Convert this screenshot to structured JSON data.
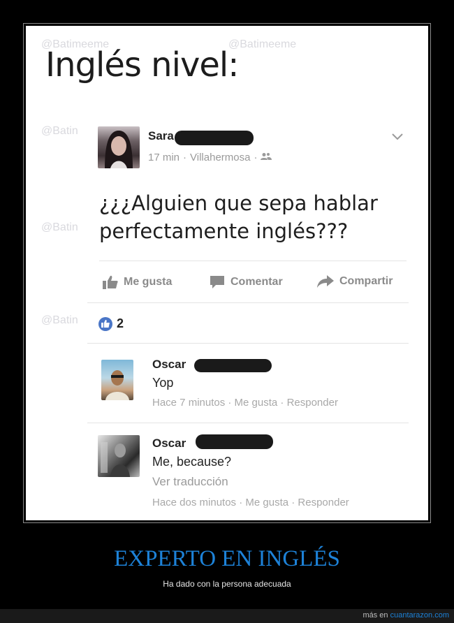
{
  "watermarks": [
    "@Batimeeme",
    "@Batimeeme",
    "@Batin",
    "@Batin",
    "@Batin"
  ],
  "headline": "Inglés nivel:",
  "post": {
    "author": "Sara",
    "time": "17 min",
    "location": "Villahermosa",
    "separator": "·",
    "text_line1": "¿¿¿Alguien que sepa hablar",
    "text_line2": "perfectamente inglés???",
    "actions": {
      "like": "Me gusta",
      "comment": "Comentar",
      "share": "Compartir"
    },
    "like_count": "2"
  },
  "comments": [
    {
      "author": "Oscar",
      "text": "Yop",
      "translate": "",
      "meta": "Hace 7 minutos · Me gusta · Responder"
    },
    {
      "author": "Oscar",
      "text": "Me, because?",
      "translate": "Ver traducción",
      "meta": "Hace dos minutos · Me gusta · Responder"
    }
  ],
  "caption": {
    "title": "EXPERTO EN INGLÉS",
    "subtitle": "Ha dado con la persona adecuada"
  },
  "footer": {
    "prefix": "más en ",
    "link": "cuantarazon.com"
  },
  "colors": {
    "accent": "#1d82d8",
    "like_blue": "#4a76c7",
    "background": "#000000"
  },
  "icons": [
    "thumbs-up-icon",
    "comment-icon",
    "share-arrow-icon",
    "friends-icon",
    "chevron-down-icon",
    "like-bubble-icon"
  ]
}
